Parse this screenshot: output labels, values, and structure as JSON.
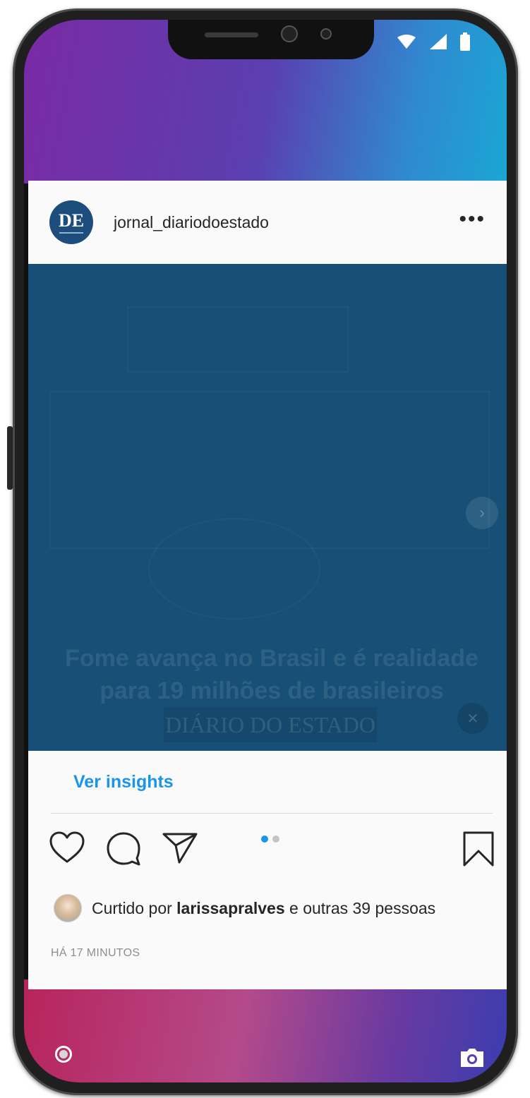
{
  "post": {
    "username": "jornal_diariodoestado",
    "avatar_text": "DE",
    "more_label": "•••",
    "media": {
      "headline": "Fome avança no Brasil e é realidade para 19 milhões de brasileiros",
      "brand": "DIÁRIO DO ESTADO",
      "background_color": "#174f76",
      "carousel_index": 1,
      "carousel_count": 2
    },
    "insights_label": "Ver insights",
    "likes": {
      "prefix": "Curtido por",
      "user": "larissapralves",
      "suffix": "e outras 39 pessoas"
    },
    "timestamp": "HÁ 17 MINUTOS"
  },
  "icons": [
    "wifi-icon",
    "signal-icon",
    "battery-icon",
    "more-icon",
    "heart-icon",
    "comment-icon",
    "share-icon",
    "bookmark-icon",
    "record-icon",
    "camera-icon"
  ],
  "colors": {
    "accent": "#1a95e8",
    "text": "#262626",
    "muted": "#8e8e8e"
  }
}
